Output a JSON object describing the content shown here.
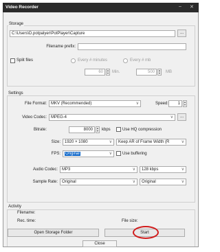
{
  "window": {
    "title": "Video Recorder",
    "minimize": "–",
    "close": "✕"
  },
  "storage": {
    "group": "Storage",
    "path": "C:\\Users\\D.potpalyer\\PotPlayer\\Capture",
    "browse": "...",
    "prefix_label": "Filename prefix:",
    "prefix_value": "",
    "split_label": "Split files",
    "every_min_label": "Every # minutes",
    "every_min_value": "60",
    "min_unit": "Min.",
    "every_mb_label": "Every # mb",
    "every_mb_value": "500",
    "mb_unit": "MB"
  },
  "settings": {
    "group": "Settings",
    "format_label": "File Format:",
    "format_value": "MKV (Recommended)",
    "speed_label": "Speed:",
    "speed_value": "1",
    "vcodec_label": "Video Codec:",
    "vcodec_value": "MPEG-4",
    "vcodec_more": "...",
    "bitrate_label": "Bitrate:",
    "bitrate_value": "8000",
    "bitrate_unit": "kbps",
    "hq_label": "Use HQ compression",
    "size_label": "Size:",
    "size_value": "1920 × 1080",
    "ar_value": "Keep AR of Frame Width (R",
    "fps_label": "FPS:",
    "fps_value": "Original",
    "buffering_label": "Use buffering",
    "acodec_label": "Audio Codec:",
    "acodec_value": "MP3",
    "abitrate_value": "128 kbps",
    "srate_label": "Sample Rate:",
    "srate_value": "Original",
    "channels_value": "Original"
  },
  "activity": {
    "group": "Activity",
    "filename_label": "Filename:",
    "rectime_label": "Rec. time:",
    "filesize_label": "File size:",
    "open_folder": "Open Storage Folder",
    "start": "Start"
  },
  "footer": {
    "close": "Close"
  },
  "colors": {
    "titlebar": "#2b2b2b",
    "highlight": "#0a64c8",
    "annotation": "#d11b1b"
  }
}
